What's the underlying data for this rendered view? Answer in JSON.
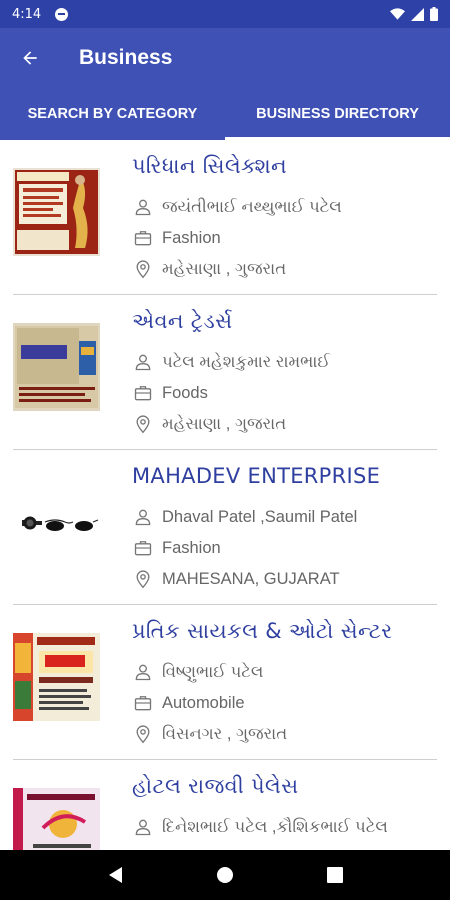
{
  "status": {
    "time": "4:14"
  },
  "appbar": {
    "title": "Business"
  },
  "tabs": [
    {
      "label": "SEARCH BY CATEGORY"
    },
    {
      "label": "BUSINESS DIRECTORY"
    }
  ],
  "colors": {
    "primary": "#3f51b5",
    "status_bar": "#2e41a6",
    "title_blue": "#2e3fa0"
  },
  "businesses": [
    {
      "name": "પરિધાન સિલેક્શન",
      "owner": "જયંતીભાઈ નથ્થુભાઈ પટેલ",
      "category": "Fashion",
      "location": "મહેસાણા , ગુજરાત"
    },
    {
      "name": "એવન ટ્રેડર્સ",
      "owner": "પટેલ મહેશકુમાર રામભાઈ",
      "category": "Foods",
      "location": "મહેસાણા , ગુજરાત"
    },
    {
      "name": "MAHADEV ENTERPRISE",
      "owner": "Dhaval Patel ,Saumil Patel",
      "category": "Fashion",
      "location": "MAHESANA, GUJARAT"
    },
    {
      "name": "પ્રતિક સાયકલ & ઓટો સેન્ટર",
      "owner": "વિષ્ણુભાઈ પટેલ",
      "category": "Automobile",
      "location": "વિસનગર , ગુજરાત"
    },
    {
      "name": "હોટલ રાજવી પેલેસ",
      "owner": "દિનેશભાઈ પટેલ ,કૌશિકભાઈ પટેલ",
      "category": "",
      "location": ""
    }
  ]
}
